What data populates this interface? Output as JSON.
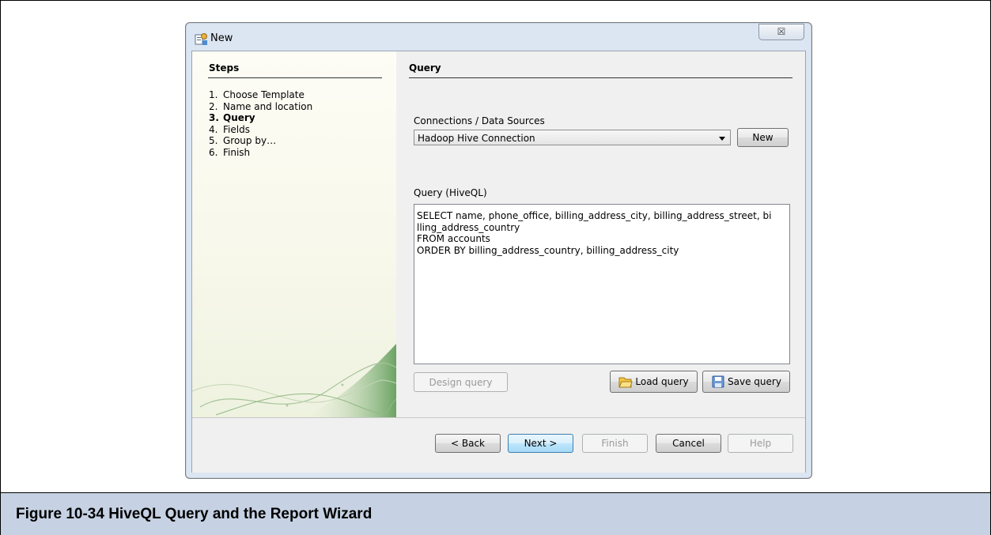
{
  "dialog": {
    "title": "New",
    "close_glyph": "☒",
    "icons": {
      "app": "report-wizard-icon",
      "close": "close-icon"
    }
  },
  "steps": {
    "heading": "Steps",
    "items": [
      {
        "num": "1.",
        "label": "Choose Template",
        "active": false
      },
      {
        "num": "2.",
        "label": "Name and location",
        "active": false
      },
      {
        "num": "3.",
        "label": "Query",
        "active": true
      },
      {
        "num": "4.",
        "label": "Fields",
        "active": false
      },
      {
        "num": "5.",
        "label": "Group by…",
        "active": false
      },
      {
        "num": "6.",
        "label": "Finish",
        "active": false
      }
    ]
  },
  "query": {
    "heading": "Query",
    "connections_label": "Connections / Data Sources",
    "connection_selected": "Hadoop Hive Connection",
    "new_label": "New",
    "query_label": "Query (HiveQL)",
    "query_lines": [
      "SELECT name, phone_office, billing_address_city, billing_address_street, bi",
      "lling_address_country",
      "FROM accounts",
      "ORDER BY billing_address_country, billing_address_city"
    ],
    "design_label": "Design query",
    "load_label": "Load query",
    "save_label": "Save query"
  },
  "footer": {
    "back": "< Back",
    "next": "Next >",
    "finish": "Finish",
    "cancel": "Cancel",
    "help": "Help"
  },
  "caption": "Figure 10-34  HiveQL Query and the Report Wizard"
}
